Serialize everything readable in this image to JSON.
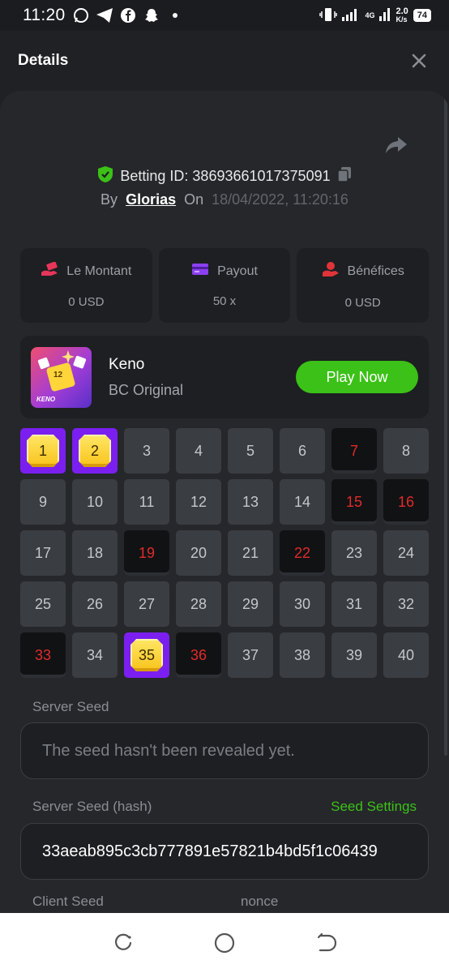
{
  "status": {
    "time": "11:20",
    "net_speed": "2.0",
    "net_unit": "K/s",
    "net_type": "4G",
    "battery": "74"
  },
  "header": {
    "title": "Details"
  },
  "bet": {
    "id_label": "Betting ID: 38693661017375091",
    "by_label": "By",
    "user": "Glorias",
    "on_label": "On",
    "date": "18/04/2022, 11:20:16"
  },
  "stats": [
    {
      "label": "Le Montant",
      "value": "0 USD",
      "icon": "money-hand-icon",
      "color": "#e6365a"
    },
    {
      "label": "Payout",
      "value": "50 x",
      "icon": "card-icon",
      "color": "#8b40f0"
    },
    {
      "label": "Bénéfices",
      "value": "0 USD",
      "icon": "profit-hand-icon",
      "color": "#e0343a"
    }
  ],
  "game": {
    "name": "Keno",
    "provider": "BC Original",
    "thumb_text": "KENO",
    "thumb_num": "12",
    "play_label": "Play Now"
  },
  "keno": {
    "numbers": [
      "1",
      "2",
      "3",
      "4",
      "5",
      "6",
      "7",
      "8",
      "9",
      "10",
      "11",
      "12",
      "13",
      "14",
      "15",
      "16",
      "17",
      "18",
      "19",
      "20",
      "21",
      "22",
      "23",
      "24",
      "25",
      "26",
      "27",
      "28",
      "29",
      "30",
      "31",
      "32",
      "33",
      "34",
      "35",
      "36",
      "37",
      "38",
      "39",
      "40"
    ],
    "hits": [
      1,
      2,
      35
    ],
    "drawn": [
      7,
      15,
      16,
      19,
      22,
      33,
      36
    ]
  },
  "seeds": {
    "server_seed_label": "Server Seed",
    "server_seed_value": "The seed hasn't been revealed yet.",
    "server_hash_label": "Server Seed (hash)",
    "seed_settings_label": "Seed Settings",
    "server_hash_value": "33aeab895c3cb777891e57821b4bd5f1c06439",
    "client_seed_label": "Client Seed",
    "nonce_label": "nonce"
  },
  "colors": {
    "accent_green": "#3bc117",
    "hit_purple": "#7a1ff0",
    "drawn_red": "#e02b2b"
  }
}
